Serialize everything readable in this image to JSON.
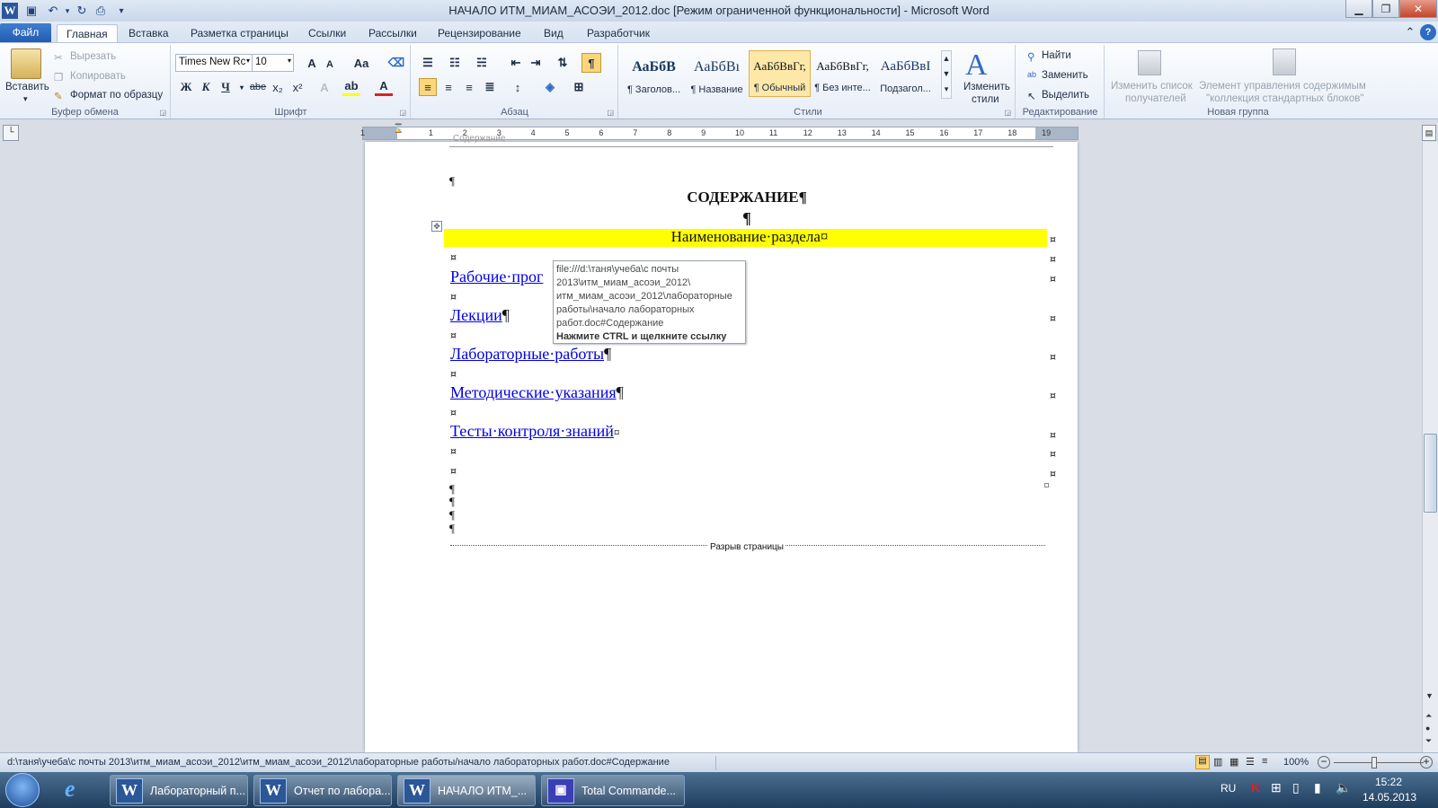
{
  "window": {
    "title": "НАЧАЛО ИТМ_МИАМ_АСОЭИ_2012.doc [Режим ограниченной функциональности]  -  Microsoft Word",
    "minimize": "▁",
    "restore": "❐",
    "close": "✕"
  },
  "tabs": [
    {
      "label": "Файл"
    },
    {
      "label": "Главная"
    },
    {
      "label": "Вставка"
    },
    {
      "label": "Разметка страницы"
    },
    {
      "label": "Ссылки"
    },
    {
      "label": "Рассылки"
    },
    {
      "label": "Рецензирование"
    },
    {
      "label": "Вид"
    },
    {
      "label": "Разработчик"
    }
  ],
  "ribbon": {
    "clipboard": {
      "label": "Буфер обмена",
      "paste": "Вставить",
      "cut": "Вырезать",
      "copy": "Копировать",
      "format_painter": "Формат по образцу"
    },
    "font": {
      "label": "Шрифт",
      "font_name": "Times New Rc",
      "font_size": "10",
      "bold": "Ж",
      "italic": "К",
      "underline": "Ч",
      "strike": "abe",
      "subscript": "x₂",
      "superscript": "x²",
      "grow": "A",
      "shrink": "A",
      "case": "Aa"
    },
    "paragraph": {
      "label": "Абзац",
      "pilcrow": "¶"
    },
    "styles": {
      "label": "Стили",
      "items": [
        {
          "sample": "АаБбВ",
          "name": "¶ Заголов..."
        },
        {
          "sample": "АаБбВı",
          "name": "¶ Название"
        },
        {
          "sample": "АаБбВвГг,",
          "name": "¶ Обычный"
        },
        {
          "sample": "АаБбВвГг,",
          "name": "¶ Без инте..."
        },
        {
          "sample": "АаБбВвI",
          "name": "Подзагол..."
        }
      ],
      "change_styles_line1": "Изменить",
      "change_styles_line2": "стили"
    },
    "editing": {
      "label": "Редактирование",
      "find": "Найти",
      "replace": "Заменить",
      "select": "Выделить"
    },
    "new_group": {
      "label": "Новая группа",
      "recipients_line1": "Изменить список",
      "recipients_line2": "получателей",
      "element_line1": "Элемент управления содержимым",
      "element_line2": "\"коллекция стандартных блоков\""
    }
  },
  "ruler": {
    "numbers": [
      "1",
      "1",
      "2",
      "3",
      "4",
      "5",
      "6",
      "7",
      "8",
      "9",
      "10",
      "11",
      "12",
      "13",
      "14",
      "15",
      "16",
      "17",
      "18",
      "19"
    ]
  },
  "document": {
    "heading": "СОДЕРЖАНИЕ¶",
    "pilcrow": "¶",
    "header_clipped": "Содержание",
    "table_header": "Наименование·раздела¤",
    "cell_mark": "¤",
    "links": [
      {
        "text": "Рабочие·прог",
        "mark": ""
      },
      {
        "text": "Лекции",
        "mark": "¶"
      },
      {
        "text": "Лабораторные·работы",
        "mark": "¶"
      },
      {
        "text": "Методические·указания",
        "mark": "¶"
      },
      {
        "text": "Тесты·контроля·знаний",
        "mark": "¤"
      }
    ],
    "page_break": "Разрыв страницы"
  },
  "tooltip": {
    "lines": [
      "file:///d:\\таня\\учеба\\с почты",
      "2013\\итм_миам_асоэи_2012\\",
      "итм_миам_асоэи_2012\\лабораторные",
      "работы\\начало лабораторных",
      "работ.doc#Содержание"
    ],
    "hint": "Нажмите CTRL и щелкните ссылку"
  },
  "status": {
    "path": "d:\\таня\\учеба\\с почты 2013\\итм_миам_асоэи_2012\\итм_миам_асоэи_2012\\лабораторные работы/начало лабораторных работ.doc#Содержание",
    "zoom": "100%"
  },
  "taskbar": {
    "items": [
      {
        "label": "Лабораторный п..."
      },
      {
        "label": "Отчет по лабора..."
      },
      {
        "label": "НАЧАЛО ИТМ_..."
      },
      {
        "label": "Total Commande..."
      }
    ],
    "lang": "RU",
    "time": "15:22",
    "date": "14.05.2013"
  },
  "colors": {
    "accent": "#2b579a",
    "highlight": "#ffff00",
    "link": "#0000e8"
  }
}
